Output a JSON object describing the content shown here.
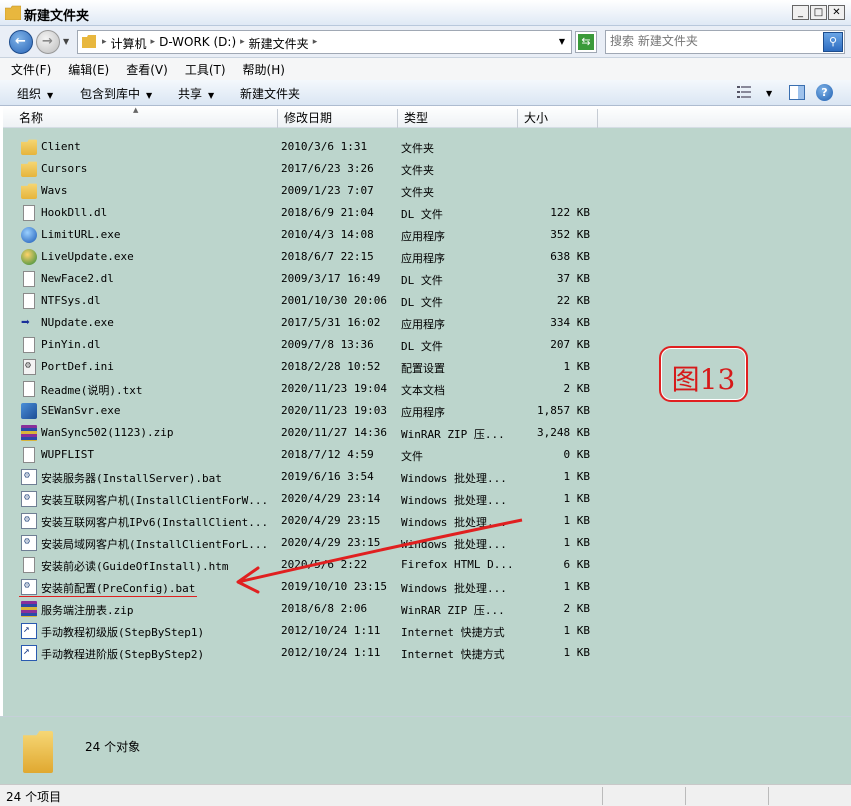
{
  "window": {
    "title": "新建文件夹",
    "btn_minimize": "_",
    "btn_maximize": "□",
    "btn_close": "✕"
  },
  "address": {
    "crumbs": [
      "计算机",
      "D-WORK (D:)",
      "新建文件夹"
    ],
    "search_placeholder": "搜索 新建文件夹"
  },
  "menu": {
    "file": "文件(F)",
    "edit": "编辑(E)",
    "view": "查看(V)",
    "tools": "工具(T)",
    "help": "帮助(H)"
  },
  "toolbar": {
    "organize": "组织",
    "include_library": "包含到库中",
    "share": "共享",
    "new_folder": "新建文件夹"
  },
  "columns": {
    "name": "名称",
    "date": "修改日期",
    "type": "类型",
    "size": "大小"
  },
  "files": [
    {
      "name": "Client",
      "date": "2010/3/6 1:31",
      "type": "文件夹",
      "size": "",
      "icon": "folder-icon"
    },
    {
      "name": "Cursors",
      "date": "2017/6/23 3:26",
      "type": "文件夹",
      "size": "",
      "icon": "folder-icon"
    },
    {
      "name": "Wavs",
      "date": "2009/1/23 7:07",
      "type": "文件夹",
      "size": "",
      "icon": "folder-icon"
    },
    {
      "name": "HookDll.dl",
      "date": "2018/6/9 21:04",
      "type": "DL 文件",
      "size": "122 KB",
      "icon": "file-icon"
    },
    {
      "name": "LimitURL.exe",
      "date": "2010/4/3 14:08",
      "type": "应用程序",
      "size": "352 KB",
      "icon": "globe-app-icon"
    },
    {
      "name": "LiveUpdate.exe",
      "date": "2018/6/7 22:15",
      "type": "应用程序",
      "size": "638 KB",
      "icon": "update-app-icon"
    },
    {
      "name": "NewFace2.dl",
      "date": "2009/3/17 16:49",
      "type": "DL 文件",
      "size": "37 KB",
      "icon": "file-icon"
    },
    {
      "name": "NTFSys.dl",
      "date": "2001/10/30 20:06",
      "type": "DL 文件",
      "size": "22 KB",
      "icon": "file-icon"
    },
    {
      "name": "NUpdate.exe",
      "date": "2017/5/31 16:02",
      "type": "应用程序",
      "size": "334 KB",
      "icon": "arrow-app-icon"
    },
    {
      "name": "PinYin.dl",
      "date": "2009/7/8 13:36",
      "type": "DL 文件",
      "size": "207 KB",
      "icon": "file-icon"
    },
    {
      "name": "PortDef.ini",
      "date": "2018/2/28 10:52",
      "type": "配置设置",
      "size": "1 KB",
      "icon": "settings-file-icon"
    },
    {
      "name": "Readme(说明).txt",
      "date": "2020/11/23 19:04",
      "type": "文本文档",
      "size": "2 KB",
      "icon": "text-file-icon"
    },
    {
      "name": "SEWanSvr.exe",
      "date": "2020/11/23 19:03",
      "type": "应用程序",
      "size": "1,857 KB",
      "icon": "system-app-icon"
    },
    {
      "name": "WanSync502(1123).zip",
      "date": "2020/11/27 14:36",
      "type": "WinRAR ZIP 压...",
      "size": "3,248 KB",
      "icon": "zip-archive-icon"
    },
    {
      "name": "WUPFLIST",
      "date": "2018/7/12 4:59",
      "type": "文件",
      "size": "0 KB",
      "icon": "file-icon"
    },
    {
      "name": "安装服务器(InstallServer).bat",
      "date": "2019/6/16 3:54",
      "type": "Windows 批处理...",
      "size": "1 KB",
      "icon": "batch-file-icon"
    },
    {
      "name": "安装互联网客户机(InstallClientForW...",
      "date": "2020/4/29 23:14",
      "type": "Windows 批处理...",
      "size": "1 KB",
      "icon": "batch-file-icon"
    },
    {
      "name": "安装互联网客户机IPv6(InstallClient...",
      "date": "2020/4/29 23:15",
      "type": "Windows 批处理...",
      "size": "1 KB",
      "icon": "batch-file-icon"
    },
    {
      "name": "安装局域网客户机(InstallClientForL...",
      "date": "2020/4/29 23:15",
      "type": "Windows 批处理...",
      "size": "1 KB",
      "icon": "batch-file-icon"
    },
    {
      "name": "安装前必读(GuideOfInstall).htm",
      "date": "2020/5/6 2:22",
      "type": "Firefox HTML D...",
      "size": "6 KB",
      "icon": "html-file-icon"
    },
    {
      "name": "安装前配置(PreConfig).bat",
      "date": "2019/10/10 23:15",
      "type": "Windows 批处理...",
      "size": "1 KB",
      "icon": "batch-file-icon"
    },
    {
      "name": "服务端注册表.zip",
      "date": "2018/6/8 2:06",
      "type": "WinRAR ZIP 压...",
      "size": "2 KB",
      "icon": "zip-archive-icon"
    },
    {
      "name": "手动教程初级版(StepByStep1)",
      "date": "2012/10/24 1:11",
      "type": "Internet 快捷方式",
      "size": "1 KB",
      "icon": "internet-shortcut-icon"
    },
    {
      "name": "手动教程进阶版(StepByStep2)",
      "date": "2012/10/24 1:11",
      "type": "Internet 快捷方式",
      "size": "1 KB",
      "icon": "internet-shortcut-icon"
    }
  ],
  "annotation": {
    "stamp_text": "图13",
    "color": "#e02020"
  },
  "details": {
    "count_text": "24 个对象"
  },
  "status": {
    "items_text": "24 个项目"
  }
}
